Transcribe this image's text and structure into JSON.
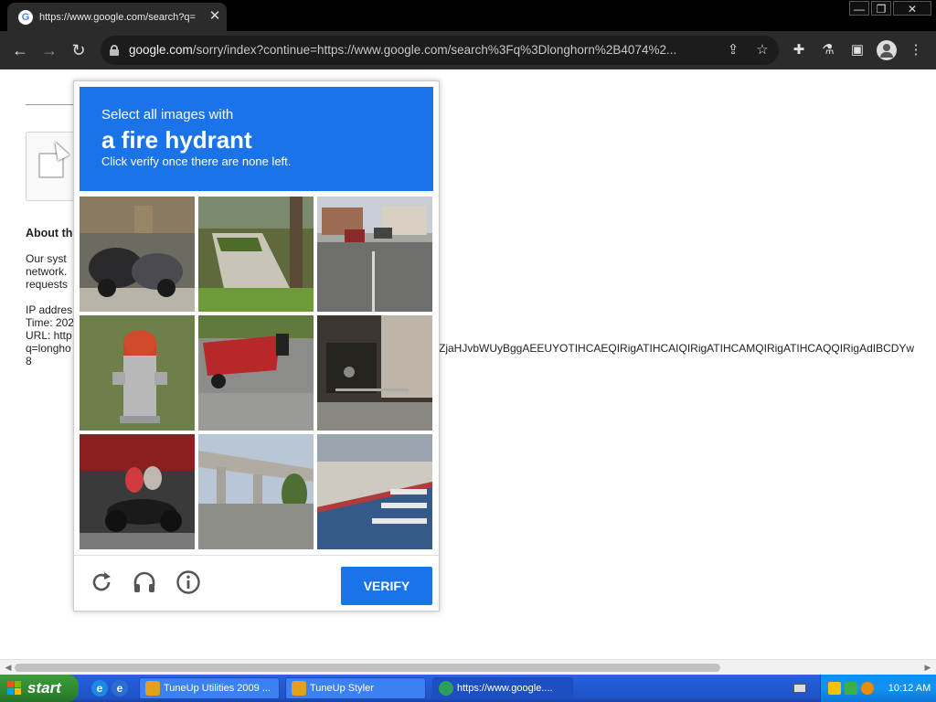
{
  "browser": {
    "tab": {
      "title": "https://www.google.com/search?q="
    },
    "address_bar": {
      "host": "google.com",
      "path": "/sorry/index?continue=https://www.google.com/search%3Fq%3Dlonghorn%2B4074%2..."
    },
    "window_controls": {
      "minimize": "—",
      "restore": "❐",
      "close": "✕"
    }
  },
  "page": {
    "about_heading": "About th",
    "body_lines": [
      "Our syst",
      "network.",
      "requests"
    ],
    "ip_label": "IP addres",
    "time_label": "Time: 202",
    "url_label": "URL: http",
    "url_query": "q=longho",
    "trailing_char": "8",
    "url_tail": "ZjaHJvbWUyBggAEEUYOTIHCAEQIRigATIHCAIQIRigATIHCAMQIRigATIHCAQQIRigAdIBCDYw"
  },
  "challenge": {
    "prompt_line1": "Select all images with",
    "prompt_target": "a fire hydrant",
    "prompt_line3": "Click verify once there are none left.",
    "tiles": [
      "motorcycles parked on a sidewalk",
      "concrete stairs and a lawn",
      "street with cars and houses",
      "red and silver fire hydrant on grass",
      "red boat trailer in a parking lot",
      "storefront with railing",
      "people on a red motorcycle",
      "highway overpass with trees",
      "curb and crosswalk on a street"
    ],
    "verify_label": "VERIFY",
    "footer_icons": [
      "reload-icon",
      "headphones-icon",
      "info-icon"
    ]
  },
  "taskbar": {
    "start_label": "start",
    "tasks": [
      {
        "label": "TuneUp Utilities 2009 ..."
      },
      {
        "label": "TuneUp Styler"
      },
      {
        "label": "https://www.google...."
      }
    ],
    "clock": "10:12 AM"
  },
  "colors": {
    "accent_blue": "#1a73e8",
    "chrome_dark": "#2b2b2b",
    "taskbar_blue": "#245edb",
    "start_green": "#2f8a2f"
  }
}
